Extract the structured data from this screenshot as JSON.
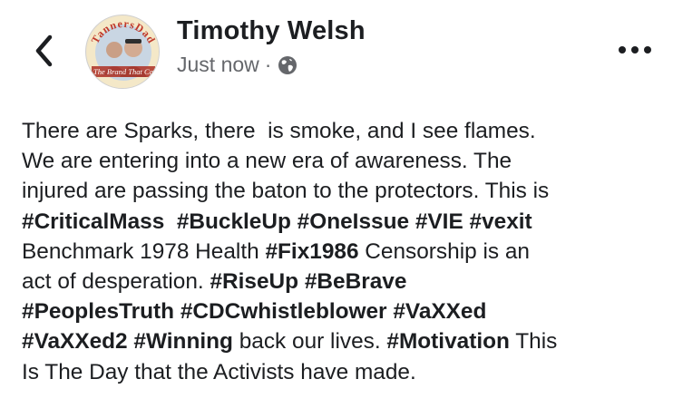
{
  "header": {
    "author_name": "Timothy Welsh",
    "timestamp": "Just now",
    "separator": "·",
    "privacy_icon": "globe-icon",
    "back_icon": "chevron-left-icon",
    "more_icon": "more-horizontal-icon"
  },
  "avatar": {
    "ring_text_top": "TannersDad",
    "ring_text_bottom": "The Brand That Ca",
    "ring_color": "#c0392b"
  },
  "post": {
    "lines": [
      [
        {
          "text": "There are Sparks, there  is smoke, and I see flames.",
          "hashtag": false
        }
      ],
      [
        {
          "text": "We are entering into a new era of awareness. The",
          "hashtag": false
        }
      ],
      [
        {
          "text": "injured are passing the baton to the protectors. This is",
          "hashtag": false
        }
      ],
      [
        {
          "text": "#CriticalMass",
          "hashtag": true
        },
        {
          "text": "  ",
          "hashtag": false
        },
        {
          "text": "#BuckleUp",
          "hashtag": true
        },
        {
          "text": " ",
          "hashtag": false
        },
        {
          "text": "#OneIssue",
          "hashtag": true
        },
        {
          "text": " ",
          "hashtag": false
        },
        {
          "text": "#VIE",
          "hashtag": true
        },
        {
          "text": " ",
          "hashtag": false
        },
        {
          "text": "#vexit",
          "hashtag": true
        }
      ],
      [
        {
          "text": "Benchmark 1978 Health ",
          "hashtag": false
        },
        {
          "text": "#Fix1986",
          "hashtag": true
        },
        {
          "text": " Censorship is an",
          "hashtag": false
        }
      ],
      [
        {
          "text": "act of desperation. ",
          "hashtag": false
        },
        {
          "text": "#RiseUp",
          "hashtag": true
        },
        {
          "text": " ",
          "hashtag": false
        },
        {
          "text": "#BeBrave",
          "hashtag": true
        }
      ],
      [
        {
          "text": "#PeoplesTruth",
          "hashtag": true
        },
        {
          "text": " ",
          "hashtag": false
        },
        {
          "text": "#CDCwhistleblower",
          "hashtag": true
        },
        {
          "text": " ",
          "hashtag": false
        },
        {
          "text": "#VaXXed",
          "hashtag": true
        }
      ],
      [
        {
          "text": "#VaXXed2",
          "hashtag": true
        },
        {
          "text": " ",
          "hashtag": false
        },
        {
          "text": "#Winning",
          "hashtag": true
        },
        {
          "text": " back our lives. ",
          "hashtag": false
        },
        {
          "text": "#Motivation",
          "hashtag": true
        },
        {
          "text": " This",
          "hashtag": false
        }
      ],
      [
        {
          "text": "Is The Day that the Activists have made.",
          "hashtag": false
        }
      ]
    ]
  },
  "colors": {
    "text": "#1c1e21",
    "secondary": "#65676b",
    "background": "#ffffff"
  }
}
